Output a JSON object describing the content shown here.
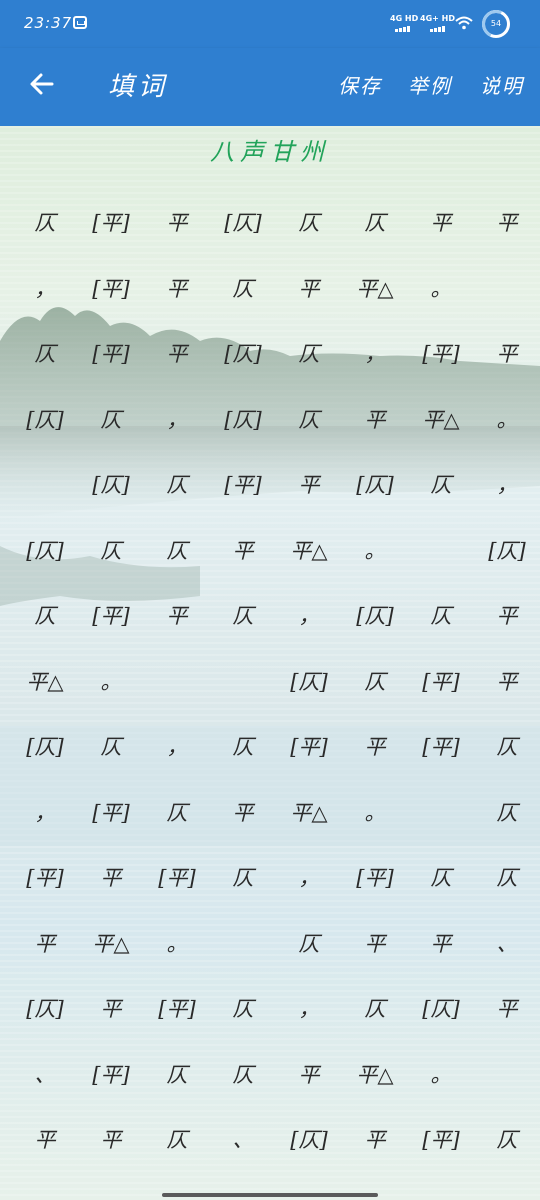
{
  "status_bar": {
    "time": "23:37",
    "network1": "4G HD",
    "network2": "4G+ HD",
    "battery": "54"
  },
  "app_bar": {
    "title": "填词",
    "actions": [
      "保存",
      "举例",
      "说明"
    ]
  },
  "poem": {
    "title": "八声甘州",
    "rows": [
      [
        "仄",
        "[平]",
        "平",
        "[仄]",
        "仄",
        "仄",
        "平",
        "平"
      ],
      [
        "，",
        "[平]",
        "平",
        "仄",
        "平",
        "平△",
        "。",
        ""
      ],
      [
        "仄",
        "[平]",
        "平",
        "[仄]",
        "仄",
        "，",
        "[平]",
        "平"
      ],
      [
        "[仄]",
        "仄",
        "，",
        "[仄]",
        "仄",
        "平",
        "平△",
        "。"
      ],
      [
        "",
        "[仄]",
        "仄",
        "[平]",
        "平",
        "[仄]",
        "仄",
        "，"
      ],
      [
        "[仄]",
        "仄",
        "仄",
        "平",
        "平△",
        "。",
        "",
        "[仄]"
      ],
      [
        "仄",
        "[平]",
        "平",
        "仄",
        "，",
        "[仄]",
        "仄",
        "平"
      ],
      [
        "平△",
        "。",
        "",
        "",
        "[仄]",
        "仄",
        "[平]",
        "平"
      ],
      [
        "[仄]",
        "仄",
        "，",
        "仄",
        "[平]",
        "平",
        "[平]",
        "仄"
      ],
      [
        "，",
        "[平]",
        "仄",
        "平",
        "平△",
        "。",
        "",
        "仄"
      ],
      [
        "[平]",
        "平",
        "[平]",
        "仄",
        "，",
        "[平]",
        "仄",
        "仄"
      ],
      [
        "平",
        "平△",
        "。",
        "",
        "仄",
        "平",
        "平",
        "、"
      ],
      [
        "[仄]",
        "平",
        "[平]",
        "仄",
        "，",
        "仄",
        "[仄]",
        "平"
      ],
      [
        "、",
        "[平]",
        "仄",
        "仄",
        "平",
        "平△",
        "。",
        ""
      ],
      [
        "平",
        "平",
        "仄",
        "、",
        "[仄]",
        "平",
        "[平]",
        "仄"
      ]
    ]
  },
  "colors": {
    "appbar": "#2f7fd0",
    "title_green": "#22a35a",
    "text": "#2a2a2a"
  }
}
